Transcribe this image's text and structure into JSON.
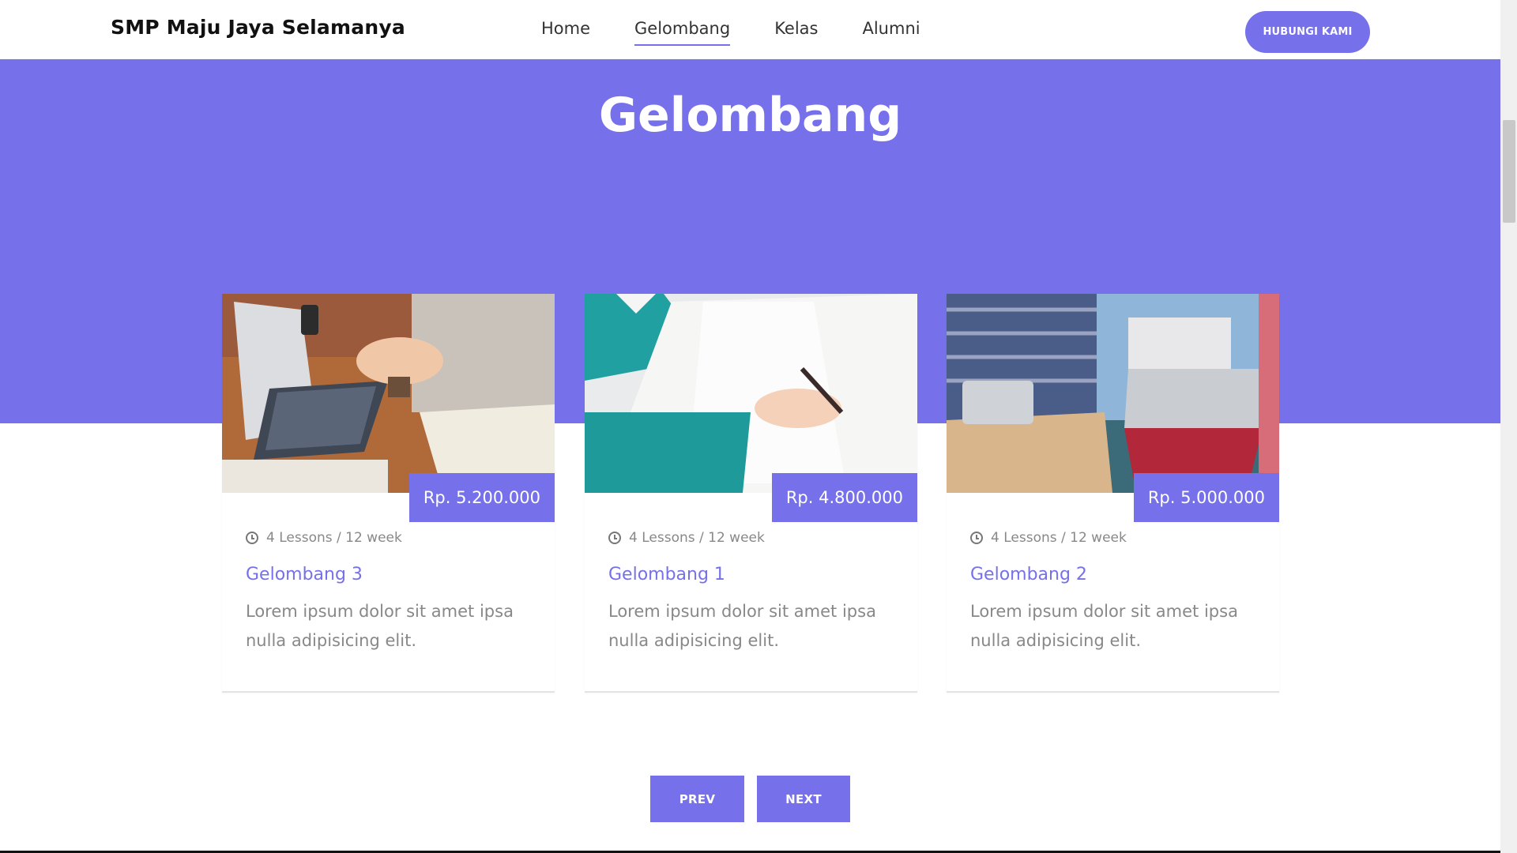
{
  "header": {
    "brand": "SMP Maju Jaya Selamanya",
    "nav": [
      {
        "label": "Home",
        "active": false
      },
      {
        "label": "Gelombang",
        "active": true
      },
      {
        "label": "Kelas",
        "active": false
      },
      {
        "label": "Alumni",
        "active": false
      }
    ],
    "cta_label": "HUBUNGI KAMI"
  },
  "hero": {
    "title": "Gelombang"
  },
  "cards": [
    {
      "image": "laptop-typing-photo",
      "price": "Rp. 5.200.000",
      "meta_icon": "clock-icon",
      "meta": "4 Lessons / 12 week",
      "title": "Gelombang 3",
      "description": "Lorem ipsum dolor sit amet ipsa nulla adipisicing elit."
    },
    {
      "image": "writing-notebook-photo",
      "price": "Rp. 4.800.000",
      "meta_icon": "clock-icon",
      "meta": "4 Lessons / 12 week",
      "title": "Gelombang 1",
      "description": "Lorem ipsum dolor sit amet ipsa nulla adipisicing elit."
    },
    {
      "image": "students-devices-photo",
      "price": "Rp. 5.000.000",
      "meta_icon": "clock-icon",
      "meta": "4 Lessons / 12 week",
      "title": "Gelombang 2",
      "description": "Lorem ipsum dolor sit amet ipsa nulla adipisicing elit."
    }
  ],
  "pagination": {
    "prev_label": "PREV",
    "next_label": "NEXT"
  },
  "colors": {
    "accent": "#7670ea",
    "text_muted": "#888888"
  }
}
